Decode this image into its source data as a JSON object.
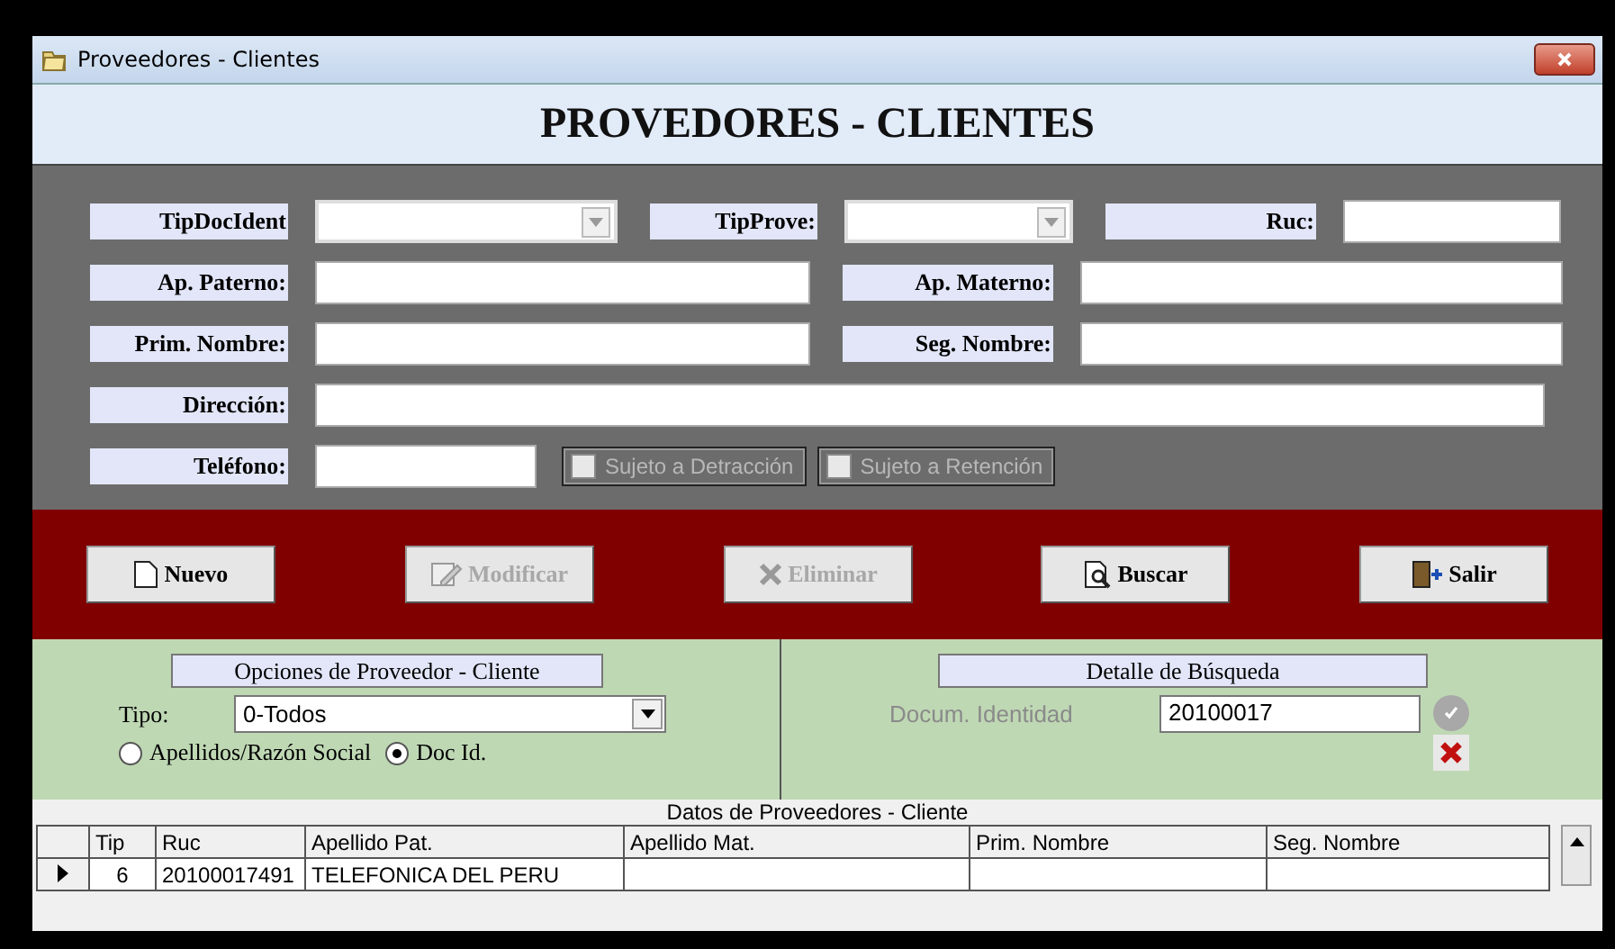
{
  "window": {
    "title": "Proveedores - Clientes"
  },
  "header": "PROVEDORES - CLIENTES",
  "form": {
    "rows": [
      {
        "fields": [
          {
            "label": "TipDocIdent",
            "kind": "combo"
          },
          {
            "label": "TipProve:",
            "kind": "combo"
          },
          {
            "label": "Ruc:",
            "kind": "text"
          }
        ]
      },
      {
        "fields": [
          {
            "label": "Ap. Paterno:",
            "kind": "text"
          },
          {
            "label": "Ap. Materno:",
            "kind": "text"
          }
        ]
      },
      {
        "fields": [
          {
            "label": "Prim. Nombre:",
            "kind": "text"
          },
          {
            "label": "Seg. Nombre:",
            "kind": "text"
          }
        ]
      },
      {
        "fields": [
          {
            "label": "Dirección:",
            "kind": "text"
          }
        ]
      },
      {
        "fields": [
          {
            "label": "Teléfono:",
            "kind": "text"
          }
        ]
      }
    ],
    "checkboxes": [
      {
        "label": "Sujeto a Detracción",
        "checked": false,
        "disabled": true
      },
      {
        "label": "Sujeto a Retención",
        "checked": false,
        "disabled": true
      }
    ]
  },
  "buttons": [
    {
      "label": "Nuevo",
      "disabled": false
    },
    {
      "label": "Modificar",
      "disabled": true
    },
    {
      "label": "Eliminar",
      "disabled": true
    },
    {
      "label": "Buscar",
      "disabled": false
    },
    {
      "label": "Salir",
      "disabled": false
    }
  ],
  "options_panel": {
    "title": "Opciones de Proveedor - Cliente",
    "tipo_label": "Tipo:",
    "tipo_value": "0-Todos",
    "radios": [
      {
        "label": "Apellidos/Razón Social",
        "selected": false
      },
      {
        "label": "Doc Id.",
        "selected": true
      }
    ]
  },
  "search_panel": {
    "title": "Detalle de Búsqueda",
    "label": "Docum. Identidad",
    "value": "20100017",
    "confirm_disabled": true
  },
  "table": {
    "caption": "Datos de Proveedores - Cliente",
    "columns": [
      "Tip",
      "Ruc",
      "Apellido Pat.",
      "Apellido Mat.",
      "Prim. Nombre",
      "Seg. Nombre"
    ],
    "rows": [
      {
        "selected": true,
        "cells": [
          "6",
          "20100017491",
          "TELEFONICA DEL PERU",
          "",
          "",
          ""
        ]
      }
    ]
  }
}
